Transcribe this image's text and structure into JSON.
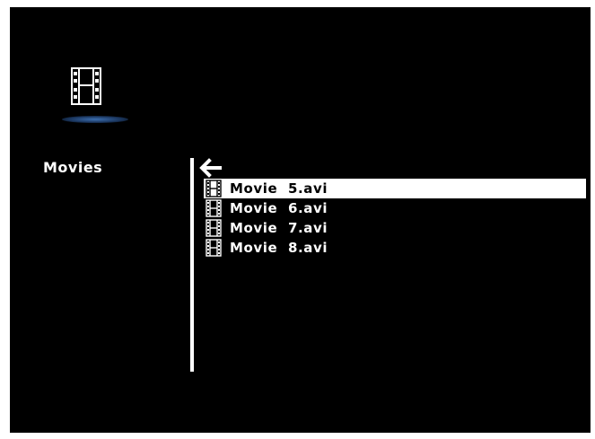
{
  "category": {
    "label": "Movies",
    "icon": "film-strip-icon"
  },
  "navigation": {
    "back_icon": "back-arrow-icon"
  },
  "files": [
    {
      "name": "Movie  5.avi",
      "icon": "film-strip-icon",
      "selected": true
    },
    {
      "name": "Movie  6.avi",
      "icon": "film-strip-icon",
      "selected": false
    },
    {
      "name": "Movie  7.avi",
      "icon": "film-strip-icon",
      "selected": false
    },
    {
      "name": "Movie  8.avi",
      "icon": "film-strip-icon",
      "selected": false
    }
  ],
  "colors": {
    "background": "#000000",
    "text": "#ffffff",
    "selection": "#ffffff",
    "selected_text": "#000000",
    "glow": "#3d6fb0"
  }
}
